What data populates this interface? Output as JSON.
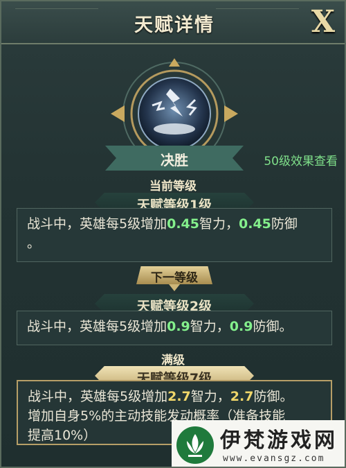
{
  "header": {
    "title": "天赋详情",
    "close_label": "X"
  },
  "talent": {
    "name": "决胜",
    "icon": "lightning-burst-icon"
  },
  "effect_link": "50级效果查看",
  "current": {
    "section_label": "当前等级",
    "level_label": "天赋等级1级",
    "desc_prefix": "战斗中，英雄每5级增加",
    "value_int": "0.45",
    "mid1": "智力，",
    "value_def": "0.45",
    "suffix": "防御",
    "tail": "。"
  },
  "next": {
    "tab_label": "下一等级",
    "level_label": "天赋等级2级",
    "desc_prefix": "战斗中，英雄每5级增加",
    "value_int": "0.9",
    "mid1": "智力，",
    "value_def": "0.9",
    "suffix": "防御。"
  },
  "max": {
    "section_label": "满级",
    "level_label": "天赋等级7级",
    "desc_prefix": "战斗中，英雄每5级增加",
    "value_int": "2.7",
    "mid1": "智力，",
    "value_def": "2.7",
    "suffix": "防御。",
    "line2": "增加自身5%的主动技能发动概率（准备技能",
    "line3": "提高10%）"
  },
  "watermark": {
    "brand": "伊梵游戏网",
    "url": "www.evansgz.com"
  },
  "colors": {
    "accent_green": "#84f08c",
    "accent_yellow": "#f0d66a",
    "gold": "#c9b27a"
  }
}
